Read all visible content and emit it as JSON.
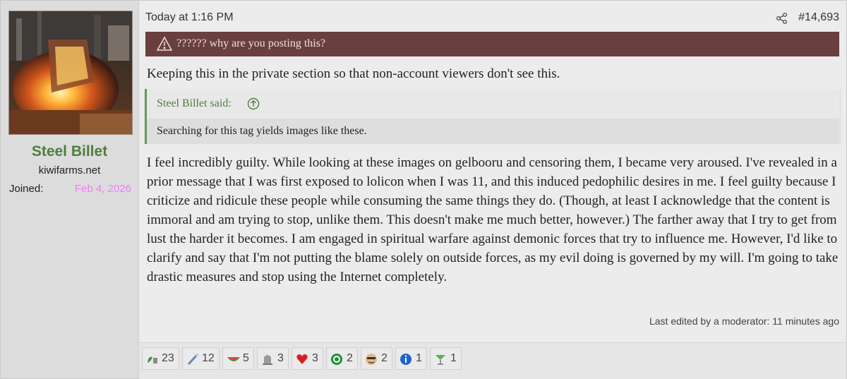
{
  "user": {
    "name": "Steel Billet",
    "title": "kiwifarms.net",
    "joined_label": "Joined:",
    "joined_value": "Feb 4, 2026"
  },
  "post": {
    "timestamp": "Today at 1:16 PM",
    "number": "#14,693",
    "notice": "?????? why are you posting this?",
    "intro": "Keeping this in the private section so that non-account viewers don't see this.",
    "quote": {
      "attribution": "Steel Billet said:",
      "text": "Searching for this tag yields images like these."
    },
    "body": "I feel incredibly guilty. While looking at these images on gelbooru and censoring them, I became very aroused. I've revealed in a prior message that I was first exposed to lolicon when I was 11, and this induced pedophilic desires in me. I feel guilty because I criticize and ridicule these people while consuming the same things they do. (Though, at least I acknowledge that the content is immoral and am trying to stop, unlike them. This doesn't make me much better, however.) The farther away that I try to get from lust the harder it becomes. I am engaged in spiritual warfare against demonic forces that try to influence me. However, I'd like to clarify and say that I'm not putting the blame solely on outside forces, as my evil doing is governed by my will. I'm going to take drastic measures and stop using the Internet completely.",
    "edited": "Last edited by a moderator: 11 minutes ago"
  },
  "reactions": [
    {
      "icon": "leaf-icon",
      "count": "23"
    },
    {
      "icon": "wand-icon",
      "count": "12"
    },
    {
      "icon": "watermelon-icon",
      "count": "5"
    },
    {
      "icon": "tombstone-icon",
      "count": "3"
    },
    {
      "icon": "heart-icon",
      "count": "3"
    },
    {
      "icon": "green-circle-icon",
      "count": "2"
    },
    {
      "icon": "face-icon",
      "count": "2"
    },
    {
      "icon": "info-icon",
      "count": "1"
    },
    {
      "icon": "cocktail-icon",
      "count": "1"
    }
  ],
  "colors": {
    "username": "#4f7d3e",
    "joined_date": "#ee7ff6",
    "notice_bg": "#6a3f3f",
    "quote_border": "#5f9c56"
  }
}
